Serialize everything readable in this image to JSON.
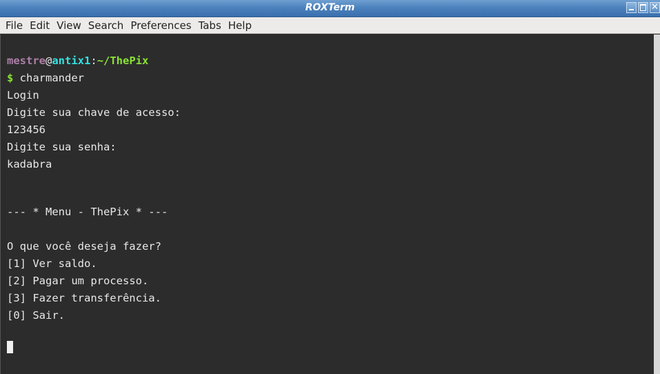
{
  "window": {
    "title": "ROXTerm",
    "buttons": {
      "minimize": "minimize-icon",
      "maximize": "maximize-icon",
      "close": "close-icon",
      "close_glyph": "✕"
    }
  },
  "menu": {
    "items": [
      "File",
      "Edit",
      "View",
      "Search",
      "Preferences",
      "Tabs",
      "Help"
    ]
  },
  "terminal": {
    "prompt": {
      "user": "mestre",
      "at": "@",
      "host": "antix1",
      "sep": ":",
      "path": "~/ThePix",
      "dollar": "$",
      "command": " charmander"
    },
    "output": [
      "Login",
      "Digite sua chave de acesso:",
      "123456",
      "Digite sua senha:",
      "kadabra",
      "",
      "",
      "--- * Menu - ThePix * ---",
      "",
      "O que você deseja fazer?",
      "[1] Ver saldo.",
      "[2] Pagar um processo.",
      "[3] Fazer transferência.",
      "[0] Sair."
    ]
  },
  "colors": {
    "terminal_bg": "#2b2b2b",
    "text": "#e8e8e8",
    "user": "#ad7fa8",
    "host": "#34e2e2",
    "path": "#8ae234",
    "titlebar": "#4c82bd"
  }
}
